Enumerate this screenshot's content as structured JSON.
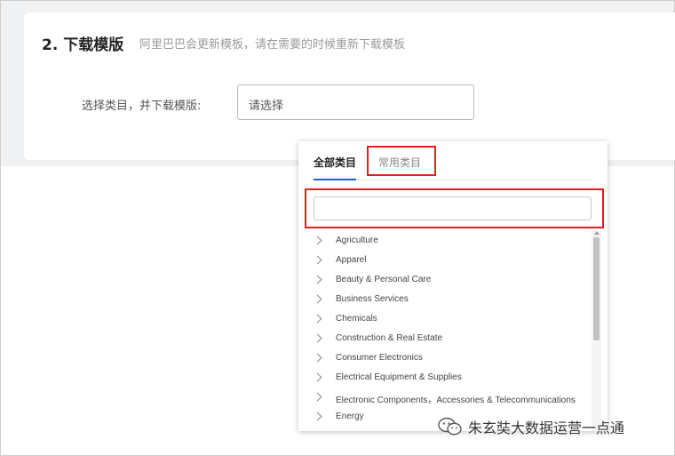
{
  "step": {
    "title": "2. 下载模版",
    "subtitle": "阿里巴巴会更新模板，请在需要的时候重新下载模板"
  },
  "category_select": {
    "label": "选择类目，并下载模版:",
    "placeholder": "请选择"
  },
  "dropdown": {
    "tabs": [
      {
        "label": "全部类目",
        "active": true
      },
      {
        "label": "常用类目",
        "active": false
      }
    ],
    "search": {
      "value": "",
      "placeholder": ""
    },
    "items": [
      {
        "label": "Agriculture"
      },
      {
        "label": "Apparel"
      },
      {
        "label": "Beauty & Personal Care"
      },
      {
        "label": "Business Services"
      },
      {
        "label": "Chemicals"
      },
      {
        "label": "Construction & Real Estate"
      },
      {
        "label": "Consumer Electronics"
      },
      {
        "label": "Electrical Equipment & Supplies"
      },
      {
        "label": "Electronic Components，Accessories & Telecommunications"
      },
      {
        "label": "Energy"
      }
    ],
    "item_icon": "chevron-right-icon"
  },
  "highlight_color": "#e0211f",
  "accent_color": "#1f5fd6",
  "watermark": {
    "text": "朱玄奘大数据运营一点通",
    "icon": "wechat-icon"
  }
}
